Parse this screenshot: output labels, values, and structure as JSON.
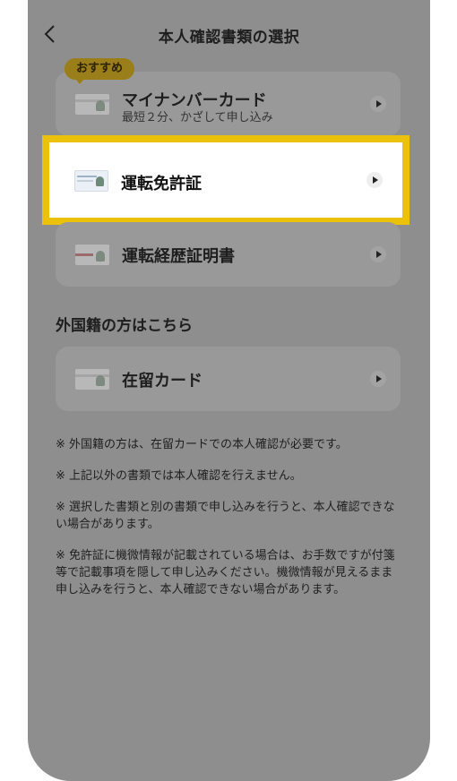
{
  "header": {
    "title": "本人確認書類の選択"
  },
  "recommended_badge": "おすすめ",
  "documents": [
    {
      "label": "マイナンバーカード",
      "sub": "最短２分、かざして申し込み"
    },
    {
      "label": "運転免許証"
    },
    {
      "label": "運転経歴証明書"
    }
  ],
  "foreign_section": {
    "title": "外国籍の方はこちら",
    "items": [
      {
        "label": "在留カード"
      }
    ]
  },
  "notes": [
    "※ 外国籍の方は、在留カードでの本人確認が必要です。",
    "※ 上記以外の書類では本人確認を行えません。",
    "※ 選択した書類と別の書類で申し込みを行うと、本人確認できない場合があります。",
    "※ 免許証に機微情報が記載されている場合は、お手数ですが付箋等で記載事項を隠して申し込みください。機微情報が見えるまま申し込みを行うと、本人確認できない場合があります。"
  ],
  "colors": {
    "overlay": "#8e8e8e",
    "highlight_border": "#ebc10b",
    "badge": "#9a7e1a"
  }
}
